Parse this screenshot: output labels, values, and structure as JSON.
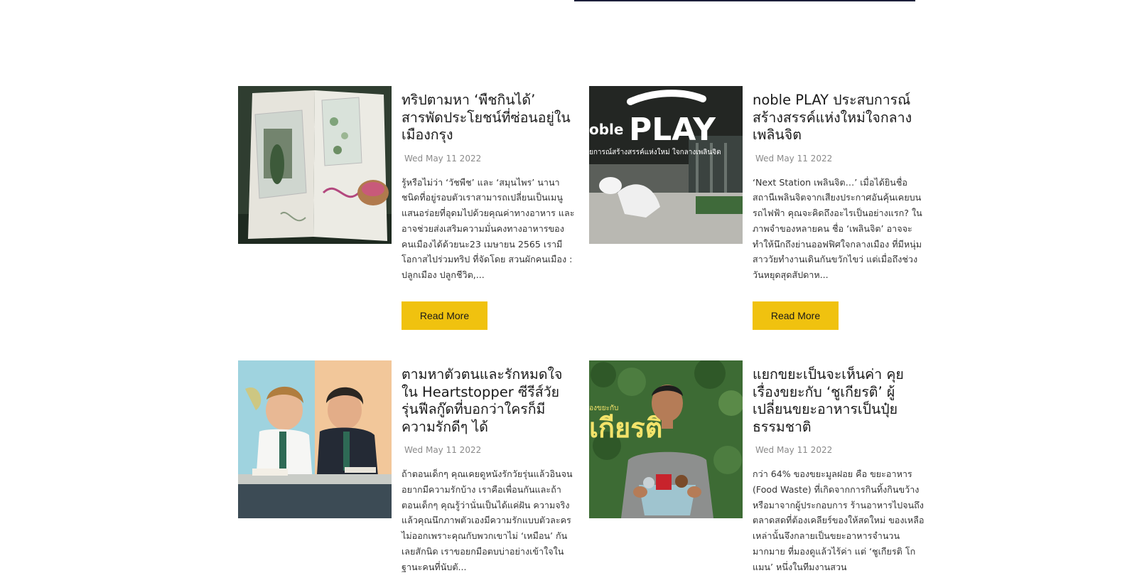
{
  "posts": [
    {
      "title": "ทริปตามหา ‘พืชกินได้’ สารพัดประโยชน์ที่ซ่อนอยู่ในเมืองกรุง",
      "date": "Wed May 11 2022",
      "excerpt": "รู้หรือไม่ว่า ‘วัชพืช’ และ ‘สมุนไพร’ นานาชนิดที่อยู่รอบตัวเราสามารถเปลี่ยนเป็นเมนูแสนอร่อยที่อุดมไปด้วยคุณค่าทางอาหาร และอาจช่วยส่งเสริมความมั่นคงทางอาหารของคนเมืองได้ด้วยนะ23 เมษายน 2565 เรามีโอกาสไปร่วมทริป ที่จัดโดย สวนผักคนเมือง : ปลูกเมือง ปลูกชีวิต,...",
      "button": "Read More",
      "image": "scrapbook-plants-image"
    },
    {
      "title": "noble PLAY ประสบการณ์สร้างสรรค์แห่งใหม่ใจกลางเพลินจิต",
      "date": "Wed May 11 2022",
      "excerpt": "‘Next Station เพลินจิต…’ เมื่อได้ยินชื่อสถานีเพลินจิตจากเสียงประกาศอันคุ้นเคยบนรถไฟฟ้า คุณจะคิดถึงอะไรเป็นอย่างแรก? ในภาพจำของหลายคน ชื่อ ‘เพลินจิต’ อาจจะทำให้นึกถึงย่านออฟฟิศใจกลางเมือง ที่มีหนุ่มสาววัยทำงานเดินกันขวักไขว่ แต่เมื่อถึงช่วงวันหยุดสุดสัปดาห...",
      "button": "Read More",
      "image": "noble-play-image",
      "image_text": {
        "brand": "oble",
        "play": "PLAY",
        "caption": "ยการณ์สร้างสรรค์แห่งใหม่ ใจกลางเพลินจิต"
      }
    },
    {
      "title": "ตามหาตัวตนและรักหมดใจ ใน Heartstopper ซีรีส์วัยรุ่นฟีลกู๊ดที่บอกว่าใครก็มีความรักดีๆ ได้",
      "date": "Wed May 11 2022",
      "excerpt": "ถ้าตอนเด็กๆ คุณเคยดูหนังรักวัยรุ่นแล้วอินจนอยากมีความรักบ้าง เราคือเพื่อนกันและถ้าตอนเด็กๆ คุณรู้ว่านั่นเป็นได้แค่ฝัน ความจริงแล้วคุณนึกภาพตัวเองมีความรักแบบตัวละครไม่ออกเพราะคุณกับพวกเขาไม่ ‘เหมือน’ กันเลยสักนิด เราขอยกมือตบบ่าอย่างเข้าใจในฐานะคนที่นับตั...",
      "button": "Read More",
      "image": "heartstopper-image"
    },
    {
      "title": "แยกขยะเป็นจะเห็นค่า คุยเรื่องขยะกับ ‘ชูเกียรติ’ ผู้เปลี่ยนขยะอาหารเป็นปุ๋ยธรรมชาติ",
      "date": "Wed May 11 2022",
      "excerpt": "กว่า 64% ของขยะมูลฝอย คือ ขยะอาหาร (Food Waste) ที่เกิดจากการกินทิ้งกินขว้าง หรือมาจากผู้ประกอบการ ร้านอาหารไปจนถึงตลาดสดที่ต้องเคลียร์ของให้สดใหม่ ของเหลือเหล่านั้นจึงกลายเป็นขยะอาหารจำนวนมากมาย ที่มองดูแล้วไร้ค่า แต่ ‘ชูเกียรติ โกแมน’ หนึ่งในทีมงานสวน",
      "button": "Read More",
      "image": "man-with-bucket-image",
      "image_text": {
        "sign_small": "องขยะกับ",
        "sign_big": "เกียรติ"
      }
    }
  ]
}
